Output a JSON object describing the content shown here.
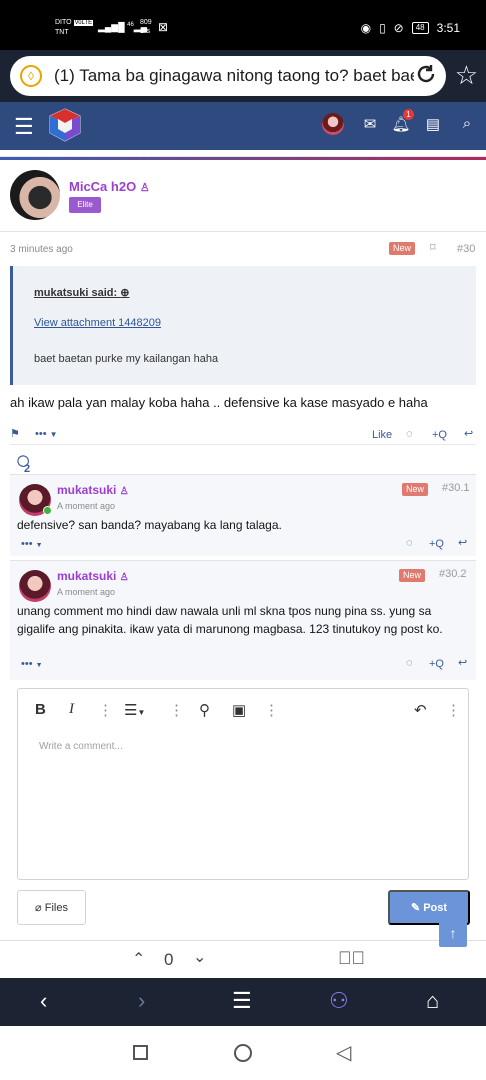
{
  "status_bar": {
    "carrier_top": "DITO",
    "carrier_tag": "VoLTE",
    "carrier_bottom": "TNT",
    "signal": "46",
    "net_speed_top": "809",
    "net_speed_bottom": "B/s",
    "battery": "48",
    "time": "3:51"
  },
  "browser": {
    "url_text": "(1) Tama ba ginagawa nitong taong to? baet baet",
    "info_icon": "info-icon",
    "reload_icon": "reload-icon",
    "bookmark_icon": "star-icon"
  },
  "forum_header": {
    "menu_icon": "hamburger-icon",
    "notification_count": "1",
    "icons": [
      "avatar",
      "mail-icon",
      "bell-icon",
      "bookmarks-icon",
      "search-icon"
    ]
  },
  "post": {
    "author": "MicCa h2O",
    "author_badge": "Elite",
    "time": "3 minutes ago",
    "new_label": "New",
    "number": "#30",
    "quote": {
      "who": "mukatsuki said:",
      "attachment": "View attachment 1448209",
      "text": "baet baetan purke my kailangan haha"
    },
    "body": "ah ikaw pala yan malay koba haha .. defensive ka kase masyado e haha",
    "more_label": "•••",
    "like_label": "Like",
    "quote_label": "+Q",
    "comment_count_label": "2 Comment"
  },
  "comments": [
    {
      "author": "mukatsuki",
      "time": "A moment ago",
      "new_label": "New",
      "number": "#30.1",
      "text": "defensive? san banda? mayabang ka lang talaga.",
      "more_label": "•••",
      "quote_label": "+Q"
    },
    {
      "author": "mukatsuki",
      "time": "A moment ago",
      "new_label": "New",
      "number": "#30.2",
      "text": "unang comment mo hindi daw nawala unli ml skna tpos nung pina ss. yung sa gigalife ang pinakita. ikaw yata di marunong magbasa. 123 tinutukoy ng post ko.",
      "more_label": "•••",
      "quote_label": "+Q"
    }
  ],
  "editor": {
    "placeholder": "Write a comment...",
    "bold_label": "B",
    "italic_label": "I",
    "files_label": "Files",
    "post_label": "Post"
  },
  "find_bar": {
    "count": "0"
  }
}
